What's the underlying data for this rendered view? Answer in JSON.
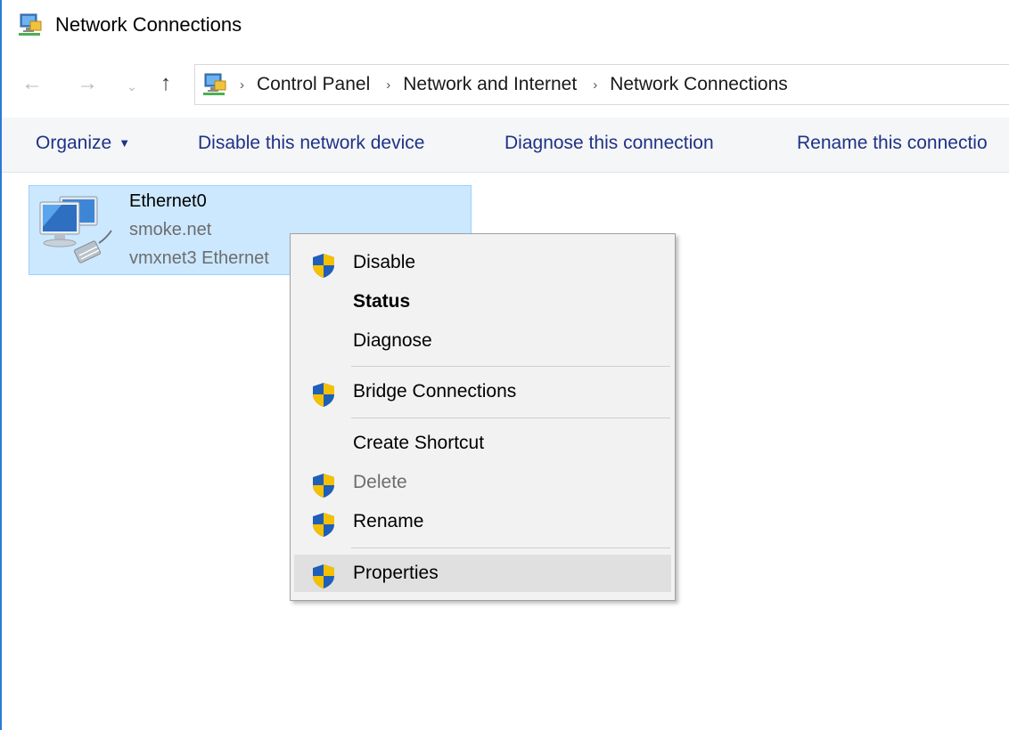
{
  "window": {
    "title": "Network Connections",
    "title_icon": "network-connections-icon",
    "accent": "#2b79d7"
  },
  "address_bar": {
    "back_glyph": "←",
    "forward_glyph": "→",
    "recent_glyph": "⌄",
    "up_glyph": "↑",
    "separator": "›",
    "breadcrumbs": [
      "Control Panel",
      "Network and Internet",
      "Network Connections"
    ]
  },
  "command_bar": {
    "organize_label": "Organize",
    "organize_caret": "▼",
    "disable_label": "Disable this network device",
    "diagnose_label": "Diagnose this connection",
    "rename_label": "Rename this connectio"
  },
  "connection": {
    "name": "Ethernet0",
    "domain": "smoke.net",
    "adapter": "vmxnet3 Ethernet",
    "selected_bg": "#cce8ff"
  },
  "context_menu": {
    "items": [
      {
        "label": "Disable",
        "shield": true
      },
      {
        "label": "Status",
        "bold": true
      },
      {
        "label": "Diagnose"
      },
      {
        "label": "Bridge Connections",
        "shield": true
      },
      {
        "label": "Create Shortcut"
      },
      {
        "label": "Delete",
        "shield": true,
        "disabled": true
      },
      {
        "label": "Rename",
        "shield": true
      },
      {
        "label": "Properties",
        "shield": true,
        "highlighted": true
      }
    ]
  }
}
